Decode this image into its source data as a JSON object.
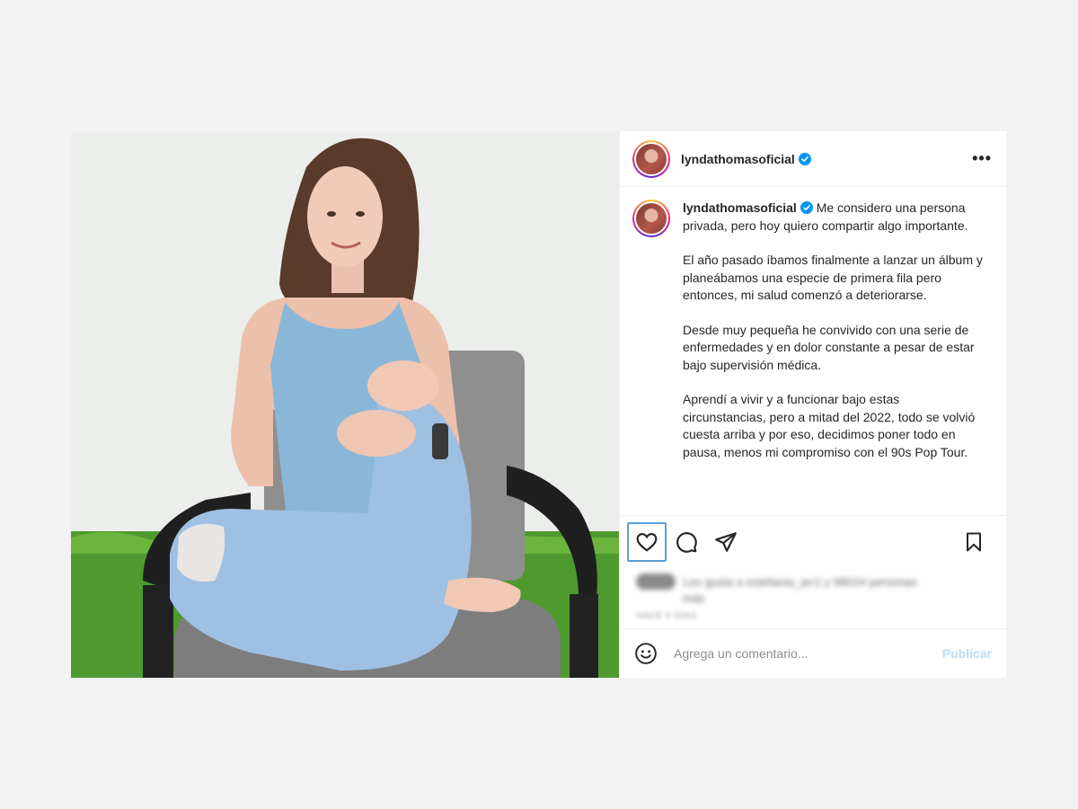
{
  "post": {
    "username": "lyndathomasoficial",
    "verified": true,
    "more_label": "•••",
    "caption": {
      "username": "lyndathomasoficial",
      "paragraphs": [
        "Me considero una persona privada, pero hoy quiero compartir algo importante.",
        "El año pasado íbamos finalmente a lanzar un álbum y planeábamos una especie de primera fila pero entonces, mi salud comenzó a deteriorarse.",
        "Desde muy pequeña he convivido con una serie de enfermedades y en dolor constante a pesar de estar bajo supervisión médica.",
        "Aprendí a vivir y a funcionar bajo estas circunstancias, pero a mitad del 2022, todo se volvió cuesta arriba y por eso, decidimos poner todo en pausa, menos mi compromiso con el 90s Pop Tour."
      ]
    },
    "likes_blurred": "Les gusta a estefania_arr1 y 98024 personas",
    "likes_blurred_2": "más",
    "date_blurred": "HACE 5 DÍAS",
    "comment_placeholder": "Agrega un comentario...",
    "publish_label": "Publicar"
  },
  "icons": {
    "like": "heart-icon",
    "comment": "comment-icon",
    "share": "share-icon",
    "save": "bookmark-icon",
    "emoji": "emoji-icon",
    "verified": "verified-badge-icon",
    "more": "more-options-icon"
  },
  "colors": {
    "verified_blue": "#0095f6",
    "publish_disabled": "#b8dcfa",
    "focus_outline": "#5b9fd6"
  }
}
